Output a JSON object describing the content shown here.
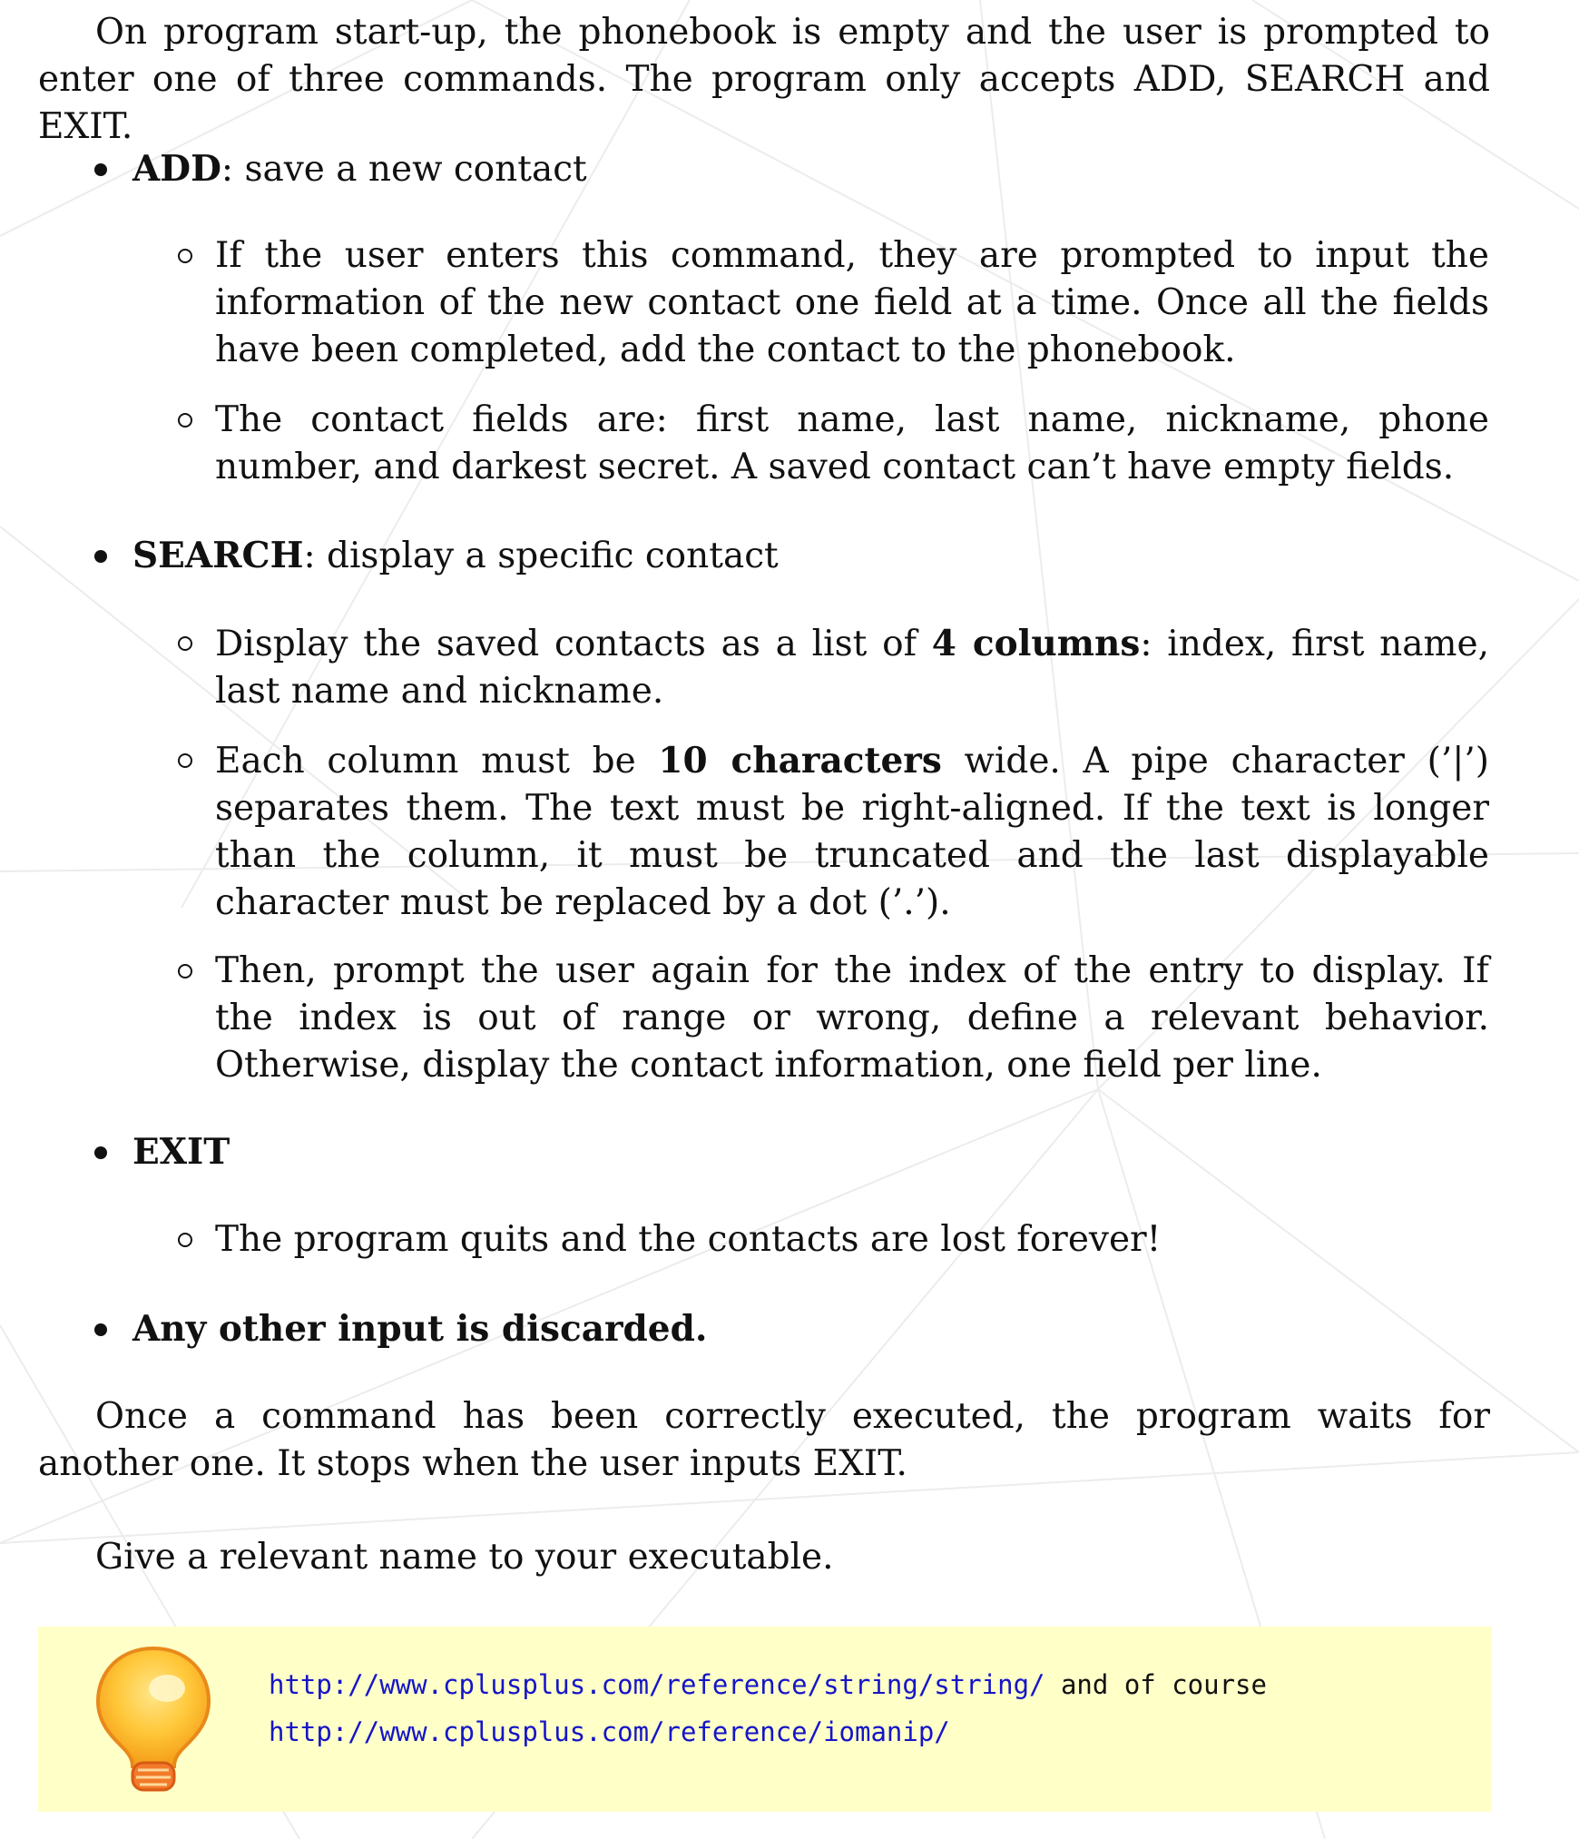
{
  "intro": {
    "text": "On program start-up, the phonebook is empty and the user is prompted to enter one of three commands. The program only accepts ADD, SEARCH and EXIT."
  },
  "commands": [
    {
      "name": "ADD",
      "desc": ": save a new contact",
      "items": [
        "If the user enters this command, they are prompted to input the information of the new contact one field at a time. Once all the fields have been completed, add the contact to the phonebook.",
        "The contact fields are: first name, last name, nickname, phone number, and darkest secret. A saved contact can’t have empty fields."
      ]
    },
    {
      "name": "SEARCH",
      "desc": ": display a specific contact",
      "items": [
        {
          "before": "Display the saved contacts as a list of ",
          "bold": "4 columns",
          "after": ": index, first name, last name and nickname."
        },
        {
          "before": "Each column must be ",
          "bold": "10 characters",
          "after": " wide. A pipe character (’|’) separates them. The text must be right-aligned. If the text is longer than the column, it must be truncated and the last displayable character must be replaced by a dot (’.’)."
        },
        "Then, prompt the user again for the index of the entry to display. If the index is out of range or wrong, define a relevant behavior. Otherwise, display the contact information, one field per line."
      ]
    },
    {
      "name": "EXIT",
      "items": [
        "The program quits and the contacts are lost forever!"
      ]
    },
    {
      "name": "Any other input is discarded."
    }
  ],
  "outro": {
    "text": "Once a command has been correctly executed, the program waits for another one. It stops when the user inputs EXIT."
  },
  "naming": {
    "text": "Give a relevant name to your executable."
  },
  "tip": {
    "icon": "lightbulb-icon",
    "link1": "http://www.cplusplus.com/reference/string/string/",
    "connector": " and of course",
    "link2": "http://www.cplusplus.com/reference/iomanip/"
  },
  "colors": {
    "tip_background": "#ffffc8",
    "link": "#1515c8"
  }
}
